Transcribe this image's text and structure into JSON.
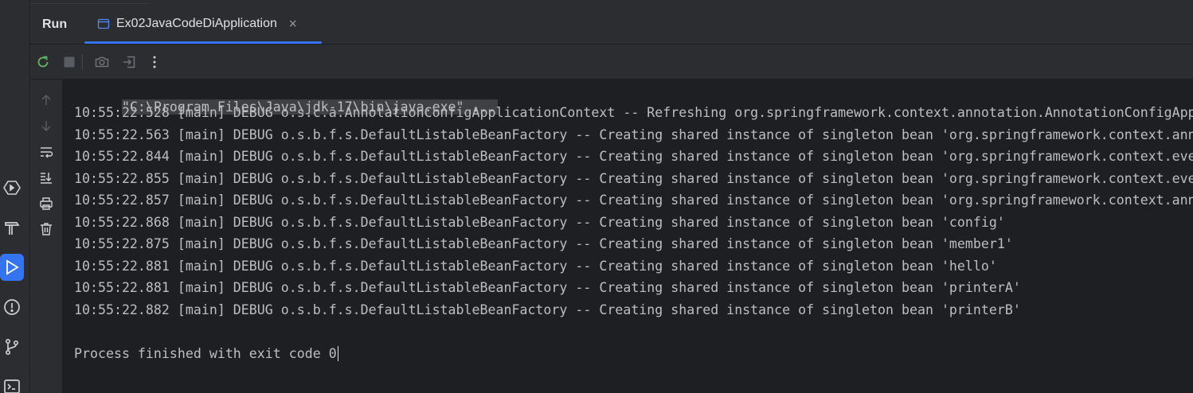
{
  "tool_window": {
    "title": "Run",
    "tab": {
      "label": "Ex02JavaCodeDiApplication",
      "close": "×"
    }
  },
  "activity_bar": {
    "icons": [
      "services-icon",
      "build-hammer-icon",
      "run-icon",
      "problems-icon",
      "git-branch-icon",
      "terminal-icon"
    ],
    "active": "run-icon",
    "accent": "#3574f0"
  },
  "toolbar": {
    "icons": [
      "rerun-icon",
      "stop-icon",
      "camera-icon",
      "exit-icon",
      "more-icon"
    ]
  },
  "console_gutter": {
    "icons": [
      "up-arrow-icon",
      "down-arrow-icon",
      "soft-wrap-icon",
      "scroll-to-end-icon",
      "print-icon",
      "trash-icon"
    ]
  },
  "console": {
    "command": "\"C:\\Program Files\\Java\\jdk-17\\bin\\java.exe\" ...",
    "lines": [
      "10:55:22.528 [main] DEBUG o.s.c.a.AnnotationConfigApplicationContext -- Refreshing org.springframework.context.annotation.AnnotationConfigApp",
      "10:55:22.563 [main] DEBUG o.s.b.f.s.DefaultListableBeanFactory -- Creating shared instance of singleton bean 'org.springframework.context.ann",
      "10:55:22.844 [main] DEBUG o.s.b.f.s.DefaultListableBeanFactory -- Creating shared instance of singleton bean 'org.springframework.context.eve",
      "10:55:22.855 [main] DEBUG o.s.b.f.s.DefaultListableBeanFactory -- Creating shared instance of singleton bean 'org.springframework.context.eve",
      "10:55:22.857 [main] DEBUG o.s.b.f.s.DefaultListableBeanFactory -- Creating shared instance of singleton bean 'org.springframework.context.ann",
      "10:55:22.868 [main] DEBUG o.s.b.f.s.DefaultListableBeanFactory -- Creating shared instance of singleton bean 'config'",
      "10:55:22.875 [main] DEBUG o.s.b.f.s.DefaultListableBeanFactory -- Creating shared instance of singleton bean 'member1'",
      "10:55:22.881 [main] DEBUG o.s.b.f.s.DefaultListableBeanFactory -- Creating shared instance of singleton bean 'hello'",
      "10:55:22.881 [main] DEBUG o.s.b.f.s.DefaultListableBeanFactory -- Creating shared instance of singleton bean 'printerA'",
      "10:55:22.882 [main] DEBUG o.s.b.f.s.DefaultListableBeanFactory -- Creating shared instance of singleton bean 'printerB'"
    ],
    "exit_message": "Process finished with exit code 0"
  }
}
